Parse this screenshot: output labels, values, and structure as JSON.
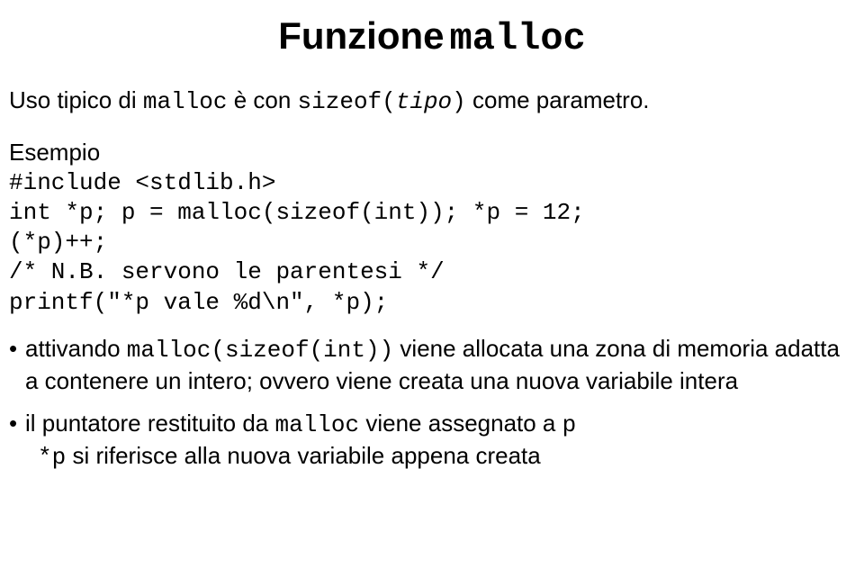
{
  "title": {
    "word": "Funzione",
    "code": "malloc"
  },
  "intro": {
    "pre": "Uso tipico di ",
    "mono1": "malloc",
    "mid": " è con ",
    "mono2": "sizeof(",
    "italic": "tipo",
    "mono3": ")",
    "post": " come parametro."
  },
  "example_label": "Esempio",
  "code": "#include <stdlib.h>\nint *p; p = malloc(sizeof(int)); *p = 12;\n(*p)++;\n/* N.B. servono le parentesi */\nprintf(\"*p vale %d\\n\", *p);",
  "bullet1": {
    "pre": "attivando ",
    "mono": "malloc(sizeof(int))",
    "post": " viene allocata una zona di memoria adatta a contenere un intero; ovvero viene creata una nuova variabile intera"
  },
  "bullet2": {
    "line1_pre": "il puntatore restituito da ",
    "line1_mono": "malloc",
    "line1_mid": " viene assegnato a ",
    "line1_mono2": "p",
    "line2_mono": "*p",
    "line2_post": " si riferisce alla nuova variabile appena creata"
  }
}
